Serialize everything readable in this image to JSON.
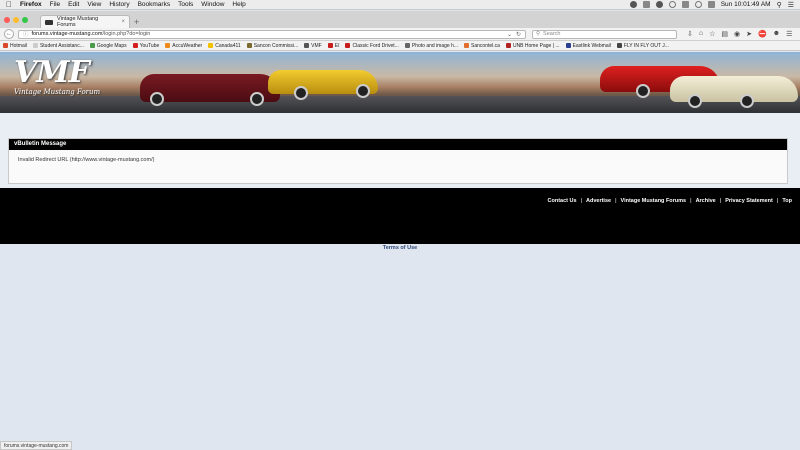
{
  "menubar": {
    "app_name": "Firefox",
    "items": [
      "File",
      "Edit",
      "View",
      "History",
      "Bookmarks",
      "Tools",
      "Window",
      "Help"
    ],
    "clock": "Sun 10:01:49 AM"
  },
  "tab": {
    "title": "Vintage Mustang Forums"
  },
  "nav": {
    "url_domain": "forums.vintage-mustang.com",
    "url_path": "/login.php?do=login",
    "search_placeholder": "Search"
  },
  "bookmarks": [
    {
      "label": "Hotmail",
      "color": "#d9482b"
    },
    {
      "label": "Student Assistanc...",
      "color": "#cccccc"
    },
    {
      "label": "Google Maps",
      "color": "#4a9a4a"
    },
    {
      "label": "YouTube",
      "color": "#d62020"
    },
    {
      "label": "AccuWeather",
      "color": "#f08a1c"
    },
    {
      "label": "Canada411",
      "color": "#f2c200"
    },
    {
      "label": "Sancon Commissi...",
      "color": "#7a6a30"
    },
    {
      "label": "VMF",
      "color": "#555555"
    },
    {
      "label": "EI",
      "color": "#c81d1d"
    },
    {
      "label": "Classic Ford Drivet...",
      "color": "#c81d1d"
    },
    {
      "label": "Photo and image h...",
      "color": "#666666"
    },
    {
      "label": "Sancontel.ca",
      "color": "#e07030"
    },
    {
      "label": "UNB Home Page | ...",
      "color": "#b02020"
    },
    {
      "label": "Eastlink Webmail",
      "color": "#2a3f8f"
    },
    {
      "label": "FLY IN FLY OUT J...",
      "color": "#444444"
    }
  ],
  "header": {
    "logo_text": "VMF",
    "logo_subtitle": "Vintage Mustang Forum"
  },
  "message": {
    "title": "vBulletin Message",
    "body": "Invalid Redirect URL (http://www.vintage-mustang.com/)"
  },
  "footer": {
    "links": [
      "Contact Us",
      "Advertise",
      "Vintage Mustang Forums",
      "Archive",
      "Privacy Statement",
      "Top"
    ],
    "separator": "|",
    "terms": "Terms of Use"
  },
  "status": {
    "text": "forums.vintage-mustang.com"
  },
  "colors": {
    "footer_bg": "#000000",
    "page_bg": "#dfe6ef",
    "terms_link": "#2c4a78"
  }
}
